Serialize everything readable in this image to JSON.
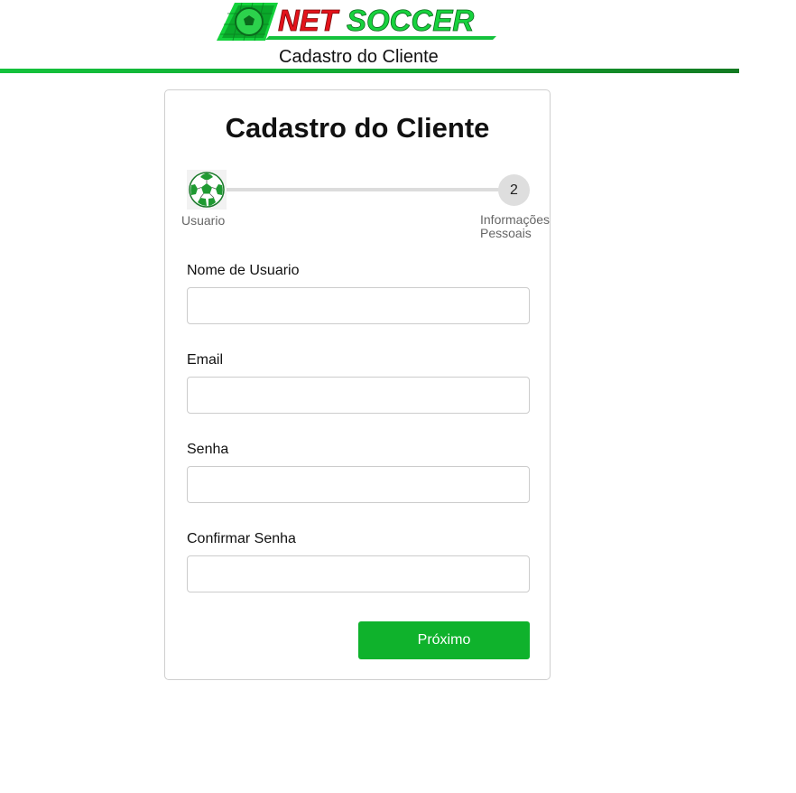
{
  "header": {
    "logo_text": "NETSOCCER",
    "subtitle": "Cadastro do Cliente"
  },
  "card": {
    "title": "Cadastro do Cliente"
  },
  "stepper": {
    "step1_label": "Usuario",
    "step2_number": "2",
    "step2_label_line1": "Informações",
    "step2_label_line2": "Pessoais"
  },
  "form": {
    "username_label": "Nome de Usuario",
    "username_value": "",
    "email_label": "Email",
    "email_value": "",
    "password_label": "Senha",
    "password_value": "",
    "confirm_label": "Confirmar Senha",
    "confirm_value": "",
    "next_button": "Próximo"
  },
  "colors": {
    "brand_green": "#0fb22c",
    "logo_red": "#e3131b"
  },
  "icons": {
    "step1": "soccer-ball-icon",
    "logo": "soccer-ball-icon"
  }
}
